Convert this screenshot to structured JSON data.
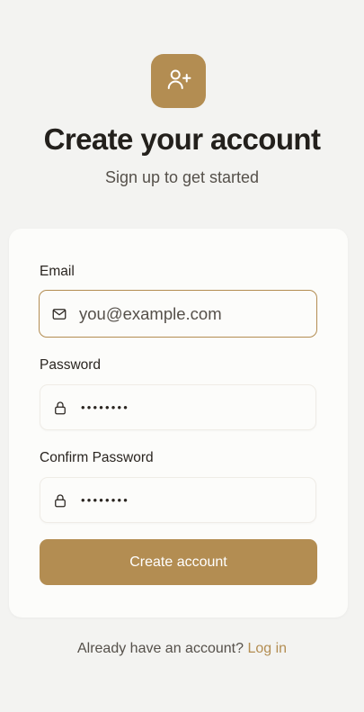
{
  "colors": {
    "accent": "#b38d52",
    "background": "#f3f3f1",
    "card": "#fcfcfa"
  },
  "header": {
    "logo_icon": "user-plus-icon",
    "title": "Create your account",
    "subtitle": "Sign up to get started"
  },
  "form": {
    "email": {
      "label": "Email",
      "icon": "mail-icon",
      "placeholder": "you@example.com"
    },
    "password": {
      "label": "Password",
      "icon": "lock-icon",
      "masked_value": "••••••••"
    },
    "confirm_password": {
      "label": "Confirm Password",
      "icon": "lock-icon",
      "masked_value": "••••••••"
    },
    "submit_label": "Create account"
  },
  "footer": {
    "prompt": "Already have an account?",
    "link_label": "Log in"
  }
}
